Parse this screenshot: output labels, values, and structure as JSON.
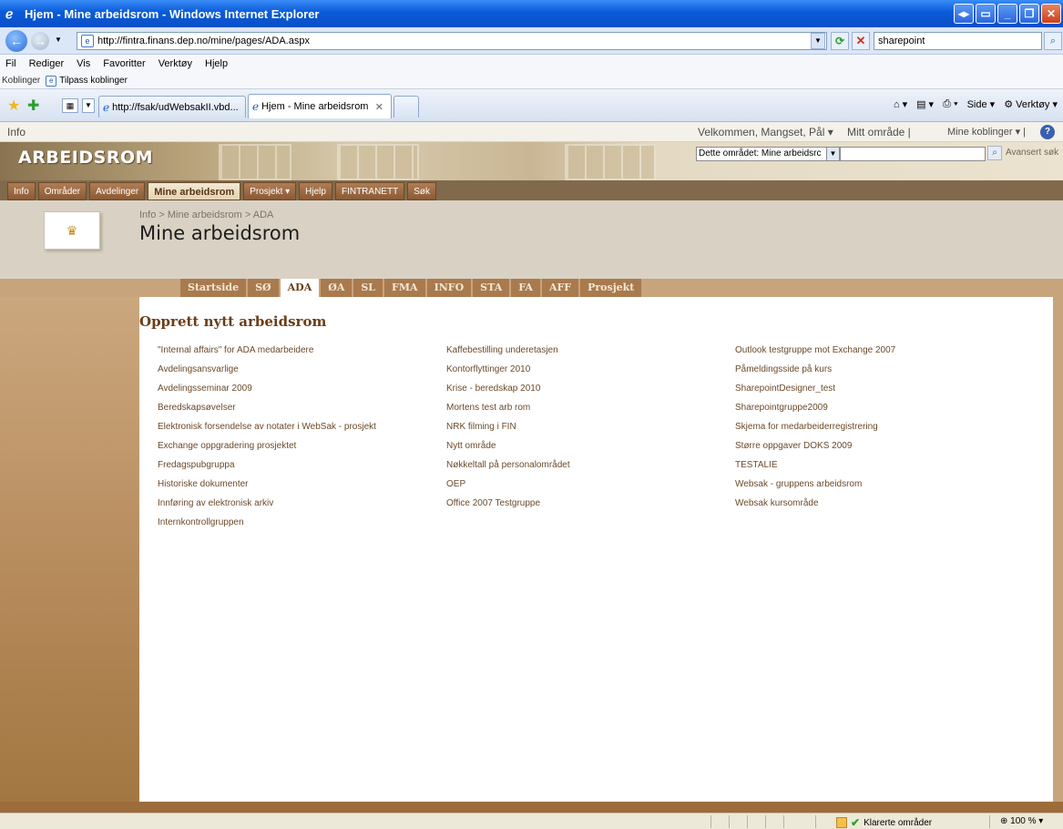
{
  "window": {
    "title": "Hjem - Mine arbeidsrom - Windows Internet Explorer"
  },
  "address": {
    "url": "http://fintra.finans.dep.no/mine/pages/ADA.aspx",
    "search_value": "sharepoint"
  },
  "menu": [
    "Fil",
    "Rediger",
    "Vis",
    "Favoritter",
    "Verktøy",
    "Hjelp"
  ],
  "links_bar": {
    "label": "Koblinger",
    "item": "Tilpass koblinger"
  },
  "browser_tabs": [
    {
      "label": "http://fsak/udWebsakII.vbd..."
    },
    {
      "label": "Hjem - Mine arbeidsrom"
    }
  ],
  "command_bar": {
    "page": "Side",
    "tools": "Verktøy"
  },
  "sp_topbar": {
    "info": "Info",
    "welcome": "Velkommen, Mangset, Pål ▾",
    "my_site": "Mitt område |",
    "my_links": "Mine koblinger ▾ |"
  },
  "sp_header": {
    "logo": "ARBEIDSROM",
    "scope": "Dette området: Mine arbeidsrc",
    "adv_search": "Avansert søk"
  },
  "sp_topnav": [
    {
      "label": "Info",
      "selected": false
    },
    {
      "label": "Områder",
      "selected": false
    },
    {
      "label": "Avdelinger",
      "selected": false
    },
    {
      "label": "Mine arbeidsrom",
      "selected": true
    },
    {
      "label": "Prosjekt ▾",
      "selected": false
    },
    {
      "label": "Hjelp",
      "selected": false
    },
    {
      "label": "FINTRANETT",
      "selected": false
    },
    {
      "label": "Søk",
      "selected": false
    }
  ],
  "page": {
    "breadcrumb": "Info > Mine arbeidsrom > ADA",
    "title": "Mine arbeidsrom"
  },
  "sp_tabs": [
    {
      "label": "Startside",
      "selected": false
    },
    {
      "label": "SØ",
      "selected": false
    },
    {
      "label": "ADA",
      "selected": true
    },
    {
      "label": "ØA",
      "selected": false
    },
    {
      "label": "SL",
      "selected": false
    },
    {
      "label": "FMA",
      "selected": false
    },
    {
      "label": "INFO",
      "selected": false
    },
    {
      "label": "STA",
      "selected": false
    },
    {
      "label": "FA",
      "selected": false
    },
    {
      "label": "AFF",
      "selected": false
    },
    {
      "label": "Prosjekt",
      "selected": false
    }
  ],
  "content": {
    "heading": "Opprett nytt arbeidsrom",
    "col1": [
      "\"Internal affairs\" for ADA medarbeidere",
      "Avdelingsansvarlige",
      "Avdelingsseminar 2009",
      "Beredskapsøvelser",
      "Elektronisk forsendelse av notater i WebSak - prosjekt",
      "Exchange oppgradering prosjektet",
      "Fredagspubgruppa",
      "Historiske dokumenter",
      "Innføring av elektronisk arkiv",
      "Internkontrollgruppen"
    ],
    "col2": [
      "Kaffebestilling underetasjen",
      "Kontorflyttinger 2010",
      "Krise - beredskap 2010",
      "Mortens test arb rom",
      "NRK filming i FIN",
      "Nytt område",
      "Nøkkeltall på personalområdet",
      "OEP",
      "Office 2007 Testgruppe"
    ],
    "col3": [
      "Outlook testgruppe mot Exchange 2007",
      "Påmeldingsside på kurs",
      "SharepointDesigner_test",
      "Sharepointgruppe2009",
      "Skjema for medarbeiderregistrering",
      "Større oppgaver DOKS 2009",
      "TESTALIE",
      "Websak - gruppens arbeidsrom",
      "Websak kursområde"
    ]
  },
  "status": {
    "zone": "Klarerte områder",
    "zoom": "100 %"
  }
}
